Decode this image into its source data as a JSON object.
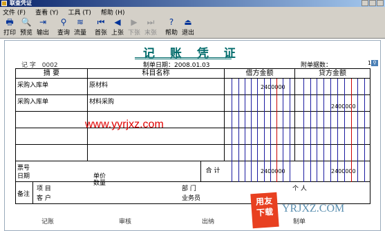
{
  "window": {
    "title": "联查凭证"
  },
  "menu": [
    "文件 (F)",
    "查看 (Y)",
    "工具 (T)",
    "帮助 (H)"
  ],
  "toolbar": [
    {
      "label": "打印",
      "icon": "printer-icon",
      "glyph": "🖶",
      "enabled": true
    },
    {
      "label": "预览",
      "icon": "preview-icon",
      "glyph": "🔍",
      "enabled": true
    },
    {
      "label": "输出",
      "icon": "export-icon",
      "glyph": "⇥",
      "enabled": true
    },
    {
      "label": "查询",
      "icon": "binoculars-icon",
      "glyph": "⚲",
      "enabled": true
    },
    {
      "label": "流量",
      "icon": "flow-icon",
      "glyph": "≋",
      "enabled": true
    },
    {
      "label": "首张",
      "icon": "first-icon",
      "glyph": "⏮",
      "enabled": true
    },
    {
      "label": "上张",
      "icon": "prev-icon",
      "glyph": "◀",
      "enabled": true
    },
    {
      "label": "下张",
      "icon": "next-icon",
      "glyph": "▶",
      "enabled": false
    },
    {
      "label": "末张",
      "icon": "last-icon",
      "glyph": "⏭",
      "enabled": false
    },
    {
      "label": "帮助",
      "icon": "help-icon",
      "glyph": "?",
      "enabled": true
    },
    {
      "label": "退出",
      "icon": "exit-icon",
      "glyph": "⏏",
      "enabled": true
    }
  ],
  "voucher": {
    "title": "记 账 凭 证",
    "type_label": "记 字",
    "number": "0002",
    "date": "制单日期：2008.01.03",
    "attachments_label": "附单据数：",
    "attachments": "1",
    "headers": {
      "summary": "摘 要",
      "account": "科目名称",
      "debit": "借方金额",
      "credit": "贷方金额"
    },
    "rows": [
      {
        "summary": "采购入库单",
        "account": "原材料",
        "debit": "2400000",
        "credit": ""
      },
      {
        "summary": "采购入库单",
        "account": "材料采购",
        "debit": "",
        "credit": "2400000"
      },
      {
        "summary": "",
        "account": "",
        "debit": "",
        "credit": ""
      },
      {
        "summary": "",
        "account": "",
        "debit": "",
        "credit": ""
      },
      {
        "summary": "",
        "account": "",
        "debit": "",
        "credit": ""
      }
    ],
    "totals": {
      "ticket_no": "票号",
      "date": "日期",
      "unit_price": "单价",
      "quantity": "数量",
      "total_label": "合 计",
      "debit_total": "2400000",
      "credit_total": "2400000"
    },
    "remarks": {
      "label": "备注",
      "project": "项 目",
      "customer": "客 户",
      "department": "部 门",
      "salesperson": "业务员",
      "individual": "个 人"
    },
    "signatures": {
      "bookkeeping": "记账",
      "audit": "审核",
      "cashier": "出纳",
      "maker": "制单"
    }
  },
  "watermark": "www.yyrjxz.com",
  "logo": {
    "badge": "用友\n下载",
    "site": "YRJXZ.COM"
  },
  "colors": {
    "title": "#006a6a",
    "debit_line": "#cc0000",
    "credit_line": "#1a1aa0",
    "watermark": "#e00000"
  }
}
